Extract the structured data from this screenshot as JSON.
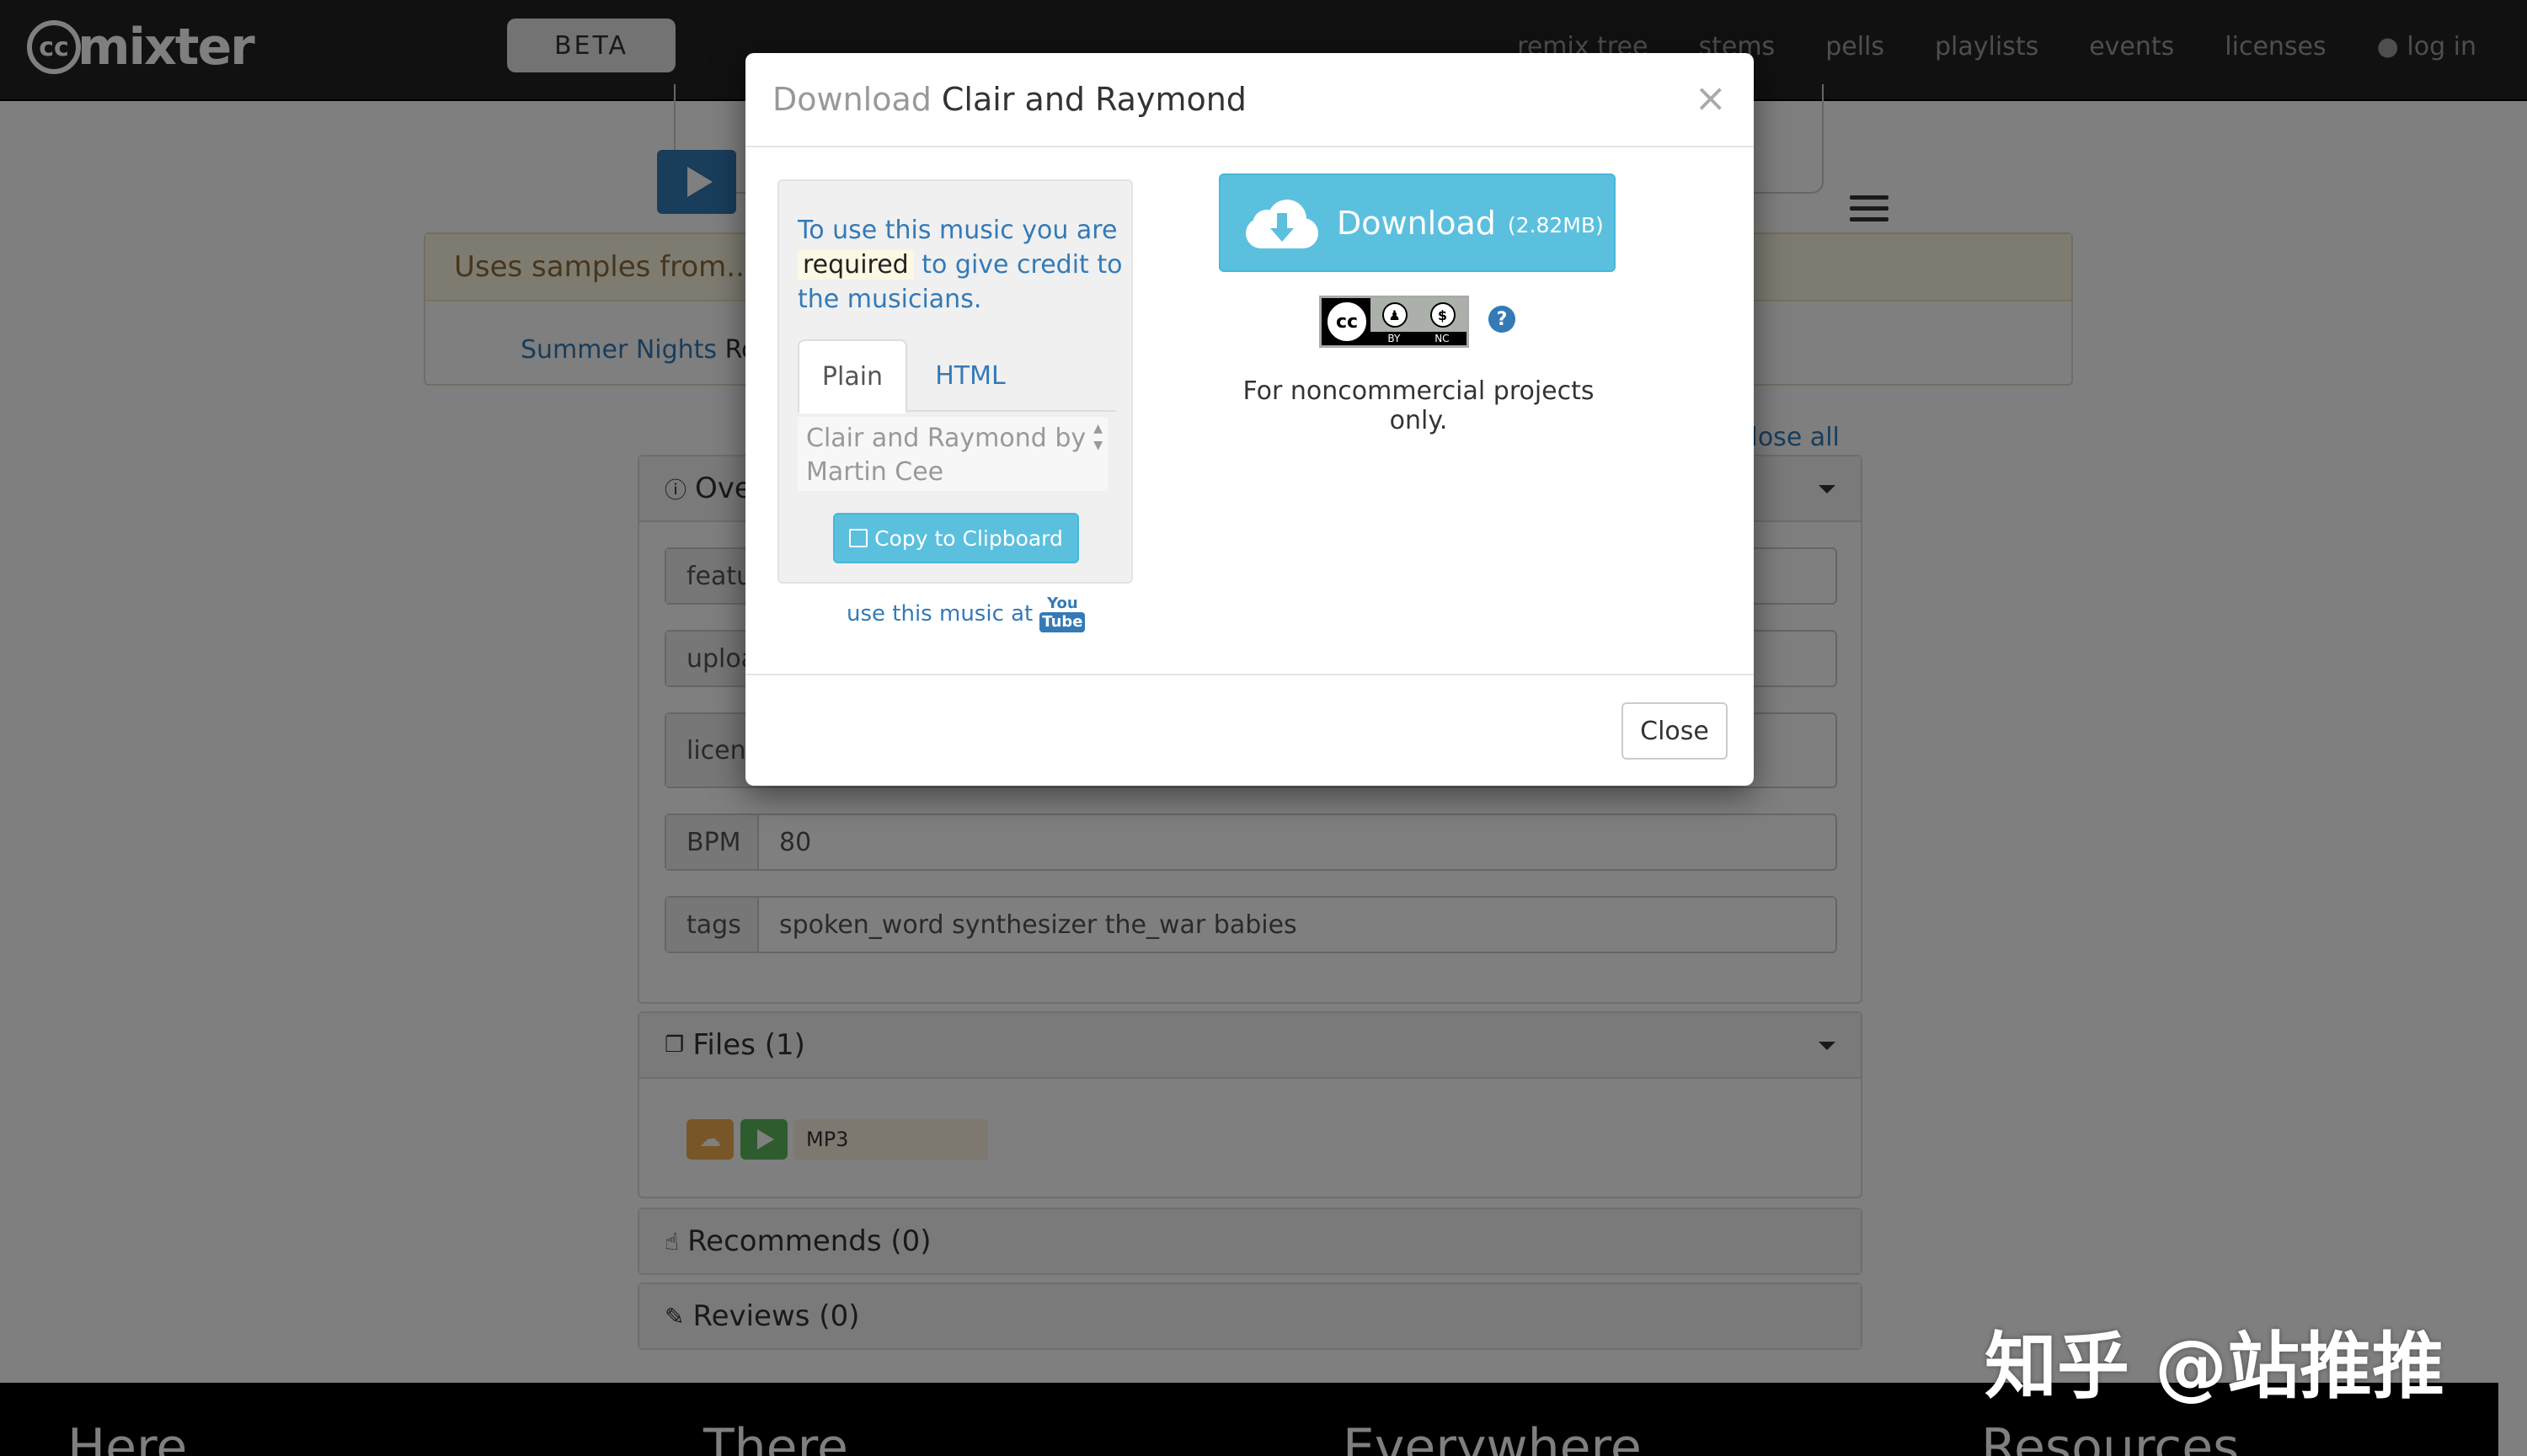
{
  "nav": {
    "logo_cc": "cc",
    "logo_word": "mixter",
    "beta": "BETA",
    "links": [
      "remix tree",
      "stems",
      "pells",
      "playlists",
      "events",
      "licenses",
      "log in"
    ]
  },
  "page": {
    "samples_heading": "Uses samples from...",
    "sample_link": "Summer Nights",
    "sample_by_fragment": "Ro",
    "close_all": "close all",
    "overview_head": "Ove",
    "fields": [
      {
        "label": "featu",
        "value": ""
      },
      {
        "label": "uploa",
        "value": ""
      },
      {
        "label": "licens",
        "value": ""
      },
      {
        "label": "BPM",
        "value": "80"
      },
      {
        "label": "tags",
        "value": "spoken_word synthesizer the_war babies"
      }
    ],
    "files_head": "Files (1)",
    "file_format": "MP3",
    "recommends_head": "Recommends (0)",
    "reviews_head": "Reviews (0)",
    "footer_cols": [
      "Here",
      "There",
      "Everywhere",
      "Resources"
    ]
  },
  "modal": {
    "title_prefix": "Download",
    "title": "Clair and Raymond",
    "close_x": "×",
    "credit_part1": "To use this music you are",
    "credit_required": "required",
    "credit_part2": "to give credit to the musicians.",
    "tab_plain": "Plain",
    "tab_html": "HTML",
    "credit_text": "Clair and Raymond by Martin Cee",
    "copy_button": "Copy to Clipboard",
    "youtube_text": "use this music at",
    "youtube_you": "You",
    "youtube_tube": "Tube",
    "download_label": "Download",
    "download_size": "(2.82MB)",
    "license_cc": "cc",
    "license_tags": [
      "BY",
      "NC"
    ],
    "help": "?",
    "license_note": "For noncommercial projects only.",
    "close_button": "Close"
  },
  "watermark": "知乎 @站推推",
  "colors": {
    "primary": "#337ab7",
    "info": "#5bc0de",
    "warning": "#f0ad4e",
    "success": "#5cb85c",
    "navbar": "#222222"
  }
}
